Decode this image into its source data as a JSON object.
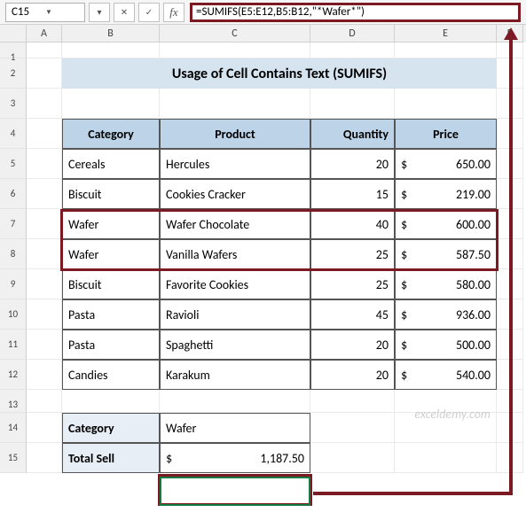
{
  "nameBox": "C15",
  "formula": "=SUMIFS(E5:E12,B5:B12,\"*Wafer*\")",
  "title": "Usage of Cell Contains Text (SUMIFS)",
  "headers": {
    "cat": "Category",
    "prod": "Product",
    "qty": "Quantity",
    "price": "Price"
  },
  "rows": [
    {
      "cat": "Cereals",
      "prod": "Hercules",
      "qty": "20",
      "price": "650.00"
    },
    {
      "cat": "Biscuit",
      "prod": "Cookies Cracker",
      "qty": "15",
      "price": "219.00"
    },
    {
      "cat": "Wafer",
      "prod": "Wafer Chocolate",
      "qty": "40",
      "price": "600.00"
    },
    {
      "cat": "Wafer",
      "prod": "Vanilla Wafers",
      "qty": "25",
      "price": "587.50"
    },
    {
      "cat": "Biscuit",
      "prod": "Favorite Cookies",
      "qty": "25",
      "price": "580.00"
    },
    {
      "cat": "Pasta",
      "prod": "Ravioli",
      "qty": "45",
      "price": "936.00"
    },
    {
      "cat": "Pasta",
      "prod": "Spaghetti",
      "qty": "20",
      "price": "500.00"
    },
    {
      "cat": "Candies",
      "prod": "Karakum",
      "qty": "20",
      "price": "540.00"
    }
  ],
  "summary": {
    "catLabel": "Category",
    "catVal": "Wafer",
    "totalLabel": "Total Sell",
    "totalVal": "1,187.50"
  },
  "cur": "$",
  "cols": {
    "A": "A",
    "B": "B",
    "C": "C",
    "D": "D",
    "E": "E",
    "F": "F"
  },
  "watermark": "exceldemy.com"
}
